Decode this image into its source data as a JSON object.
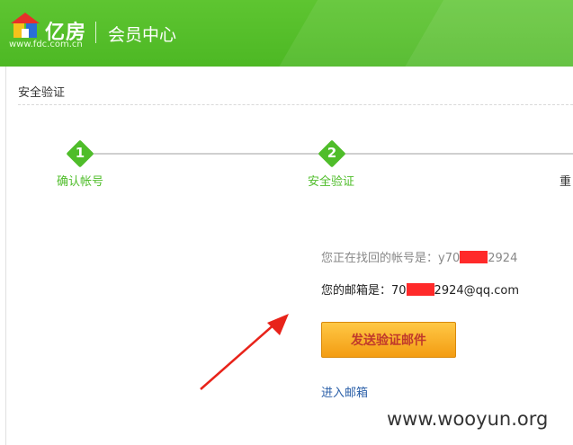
{
  "header": {
    "brand": "亿房",
    "domain": "www.fdc.com.cn",
    "subtitle": "会员中心",
    "colors": {
      "header_green": "#5ec531",
      "accent": "#4fbd2a"
    }
  },
  "panel": {
    "title": "安全验证"
  },
  "steps": [
    {
      "number": "1",
      "label": "确认帐号",
      "state": "done"
    },
    {
      "number": "2",
      "label": "安全验证",
      "state": "active"
    },
    {
      "number": "",
      "label": "重",
      "state": "pending"
    }
  ],
  "info": {
    "account_prefix": "您正在找回的帐号是：y70",
    "account_suffix": "2924",
    "email_prefix": "您的邮箱是：70",
    "email_suffix": "2924@qq.com"
  },
  "actions": {
    "send_button": "发送验证邮件",
    "enter_mailbox": "进入邮箱"
  },
  "watermark": "www.wooyun.org"
}
